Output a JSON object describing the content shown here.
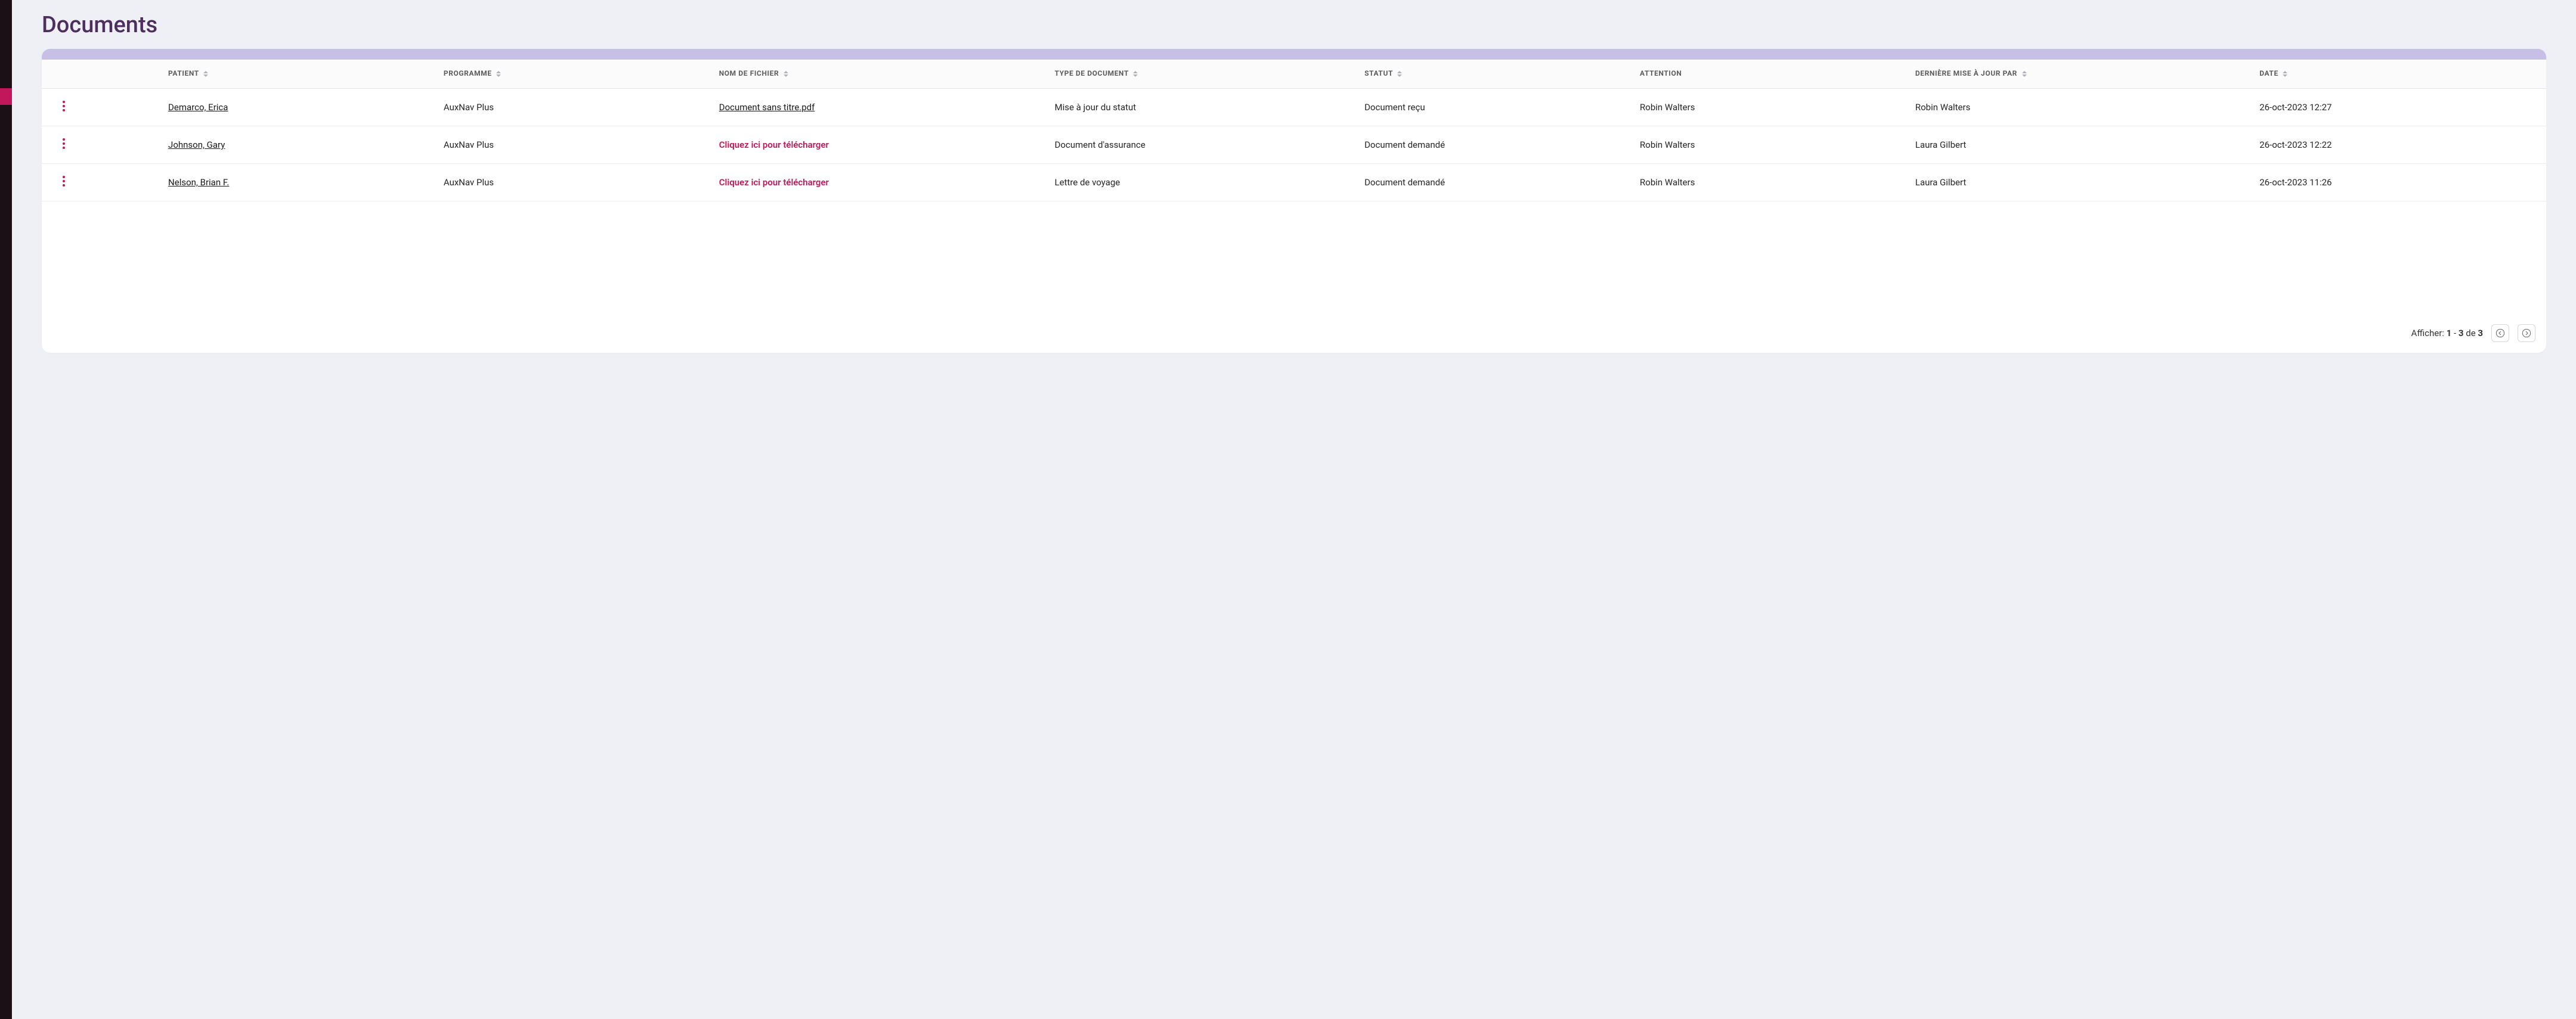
{
  "page": {
    "title": "Documents"
  },
  "columns": {
    "patient": "Patient",
    "programme": "Programme",
    "filename": "Nom de fichier",
    "doctype": "Type de document",
    "status": "Statut",
    "attention": "Attention",
    "updated_by": "Dernière mise à jour par",
    "date": "Date"
  },
  "upload_cta": "Cliquez ici pour télécharger",
  "rows": [
    {
      "patient": "Demarco, Erica",
      "programme": "AuxNav Plus",
      "filename": "Document sans titre.pdf",
      "filetype": "link",
      "doctype": "Mise à jour du statut",
      "status": "Document reçu",
      "attention": "Robin Walters",
      "updated_by": "Robin Walters",
      "date": "26-oct-2023 12:27"
    },
    {
      "patient": "Johnson, Gary",
      "programme": "AuxNav Plus",
      "filename": "",
      "filetype": "upload",
      "doctype": "Document d'assurance",
      "status": "Document demandé",
      "attention": "Robin Walters",
      "updated_by": "Laura Gilbert",
      "date": "26-oct-2023 12:22"
    },
    {
      "patient": "Nelson, Brian F.",
      "programme": "AuxNav Plus",
      "filename": "",
      "filetype": "upload",
      "doctype": "Lettre de voyage",
      "status": "Document demandé",
      "attention": "Robin Walters",
      "updated_by": "Laura Gilbert",
      "date": "26-oct-2023 11:26"
    }
  ],
  "pagination": {
    "prefix": "Afficher:",
    "from": "1",
    "dash": "-",
    "to": "3",
    "of_word": "de",
    "total": "3"
  }
}
